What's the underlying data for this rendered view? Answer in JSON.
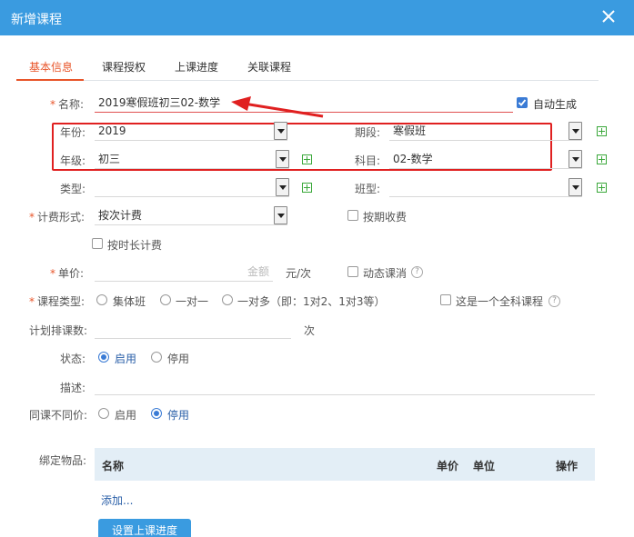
{
  "dialog": {
    "title": "新增课程"
  },
  "tabs": [
    {
      "label": "基本信息"
    },
    {
      "label": "课程授权"
    },
    {
      "label": "上课进度"
    },
    {
      "label": "关联课程"
    }
  ],
  "form": {
    "name_label": "名称:",
    "name_value": "2019寒假班初三02-数学",
    "auto_generate_label": "自动生成",
    "year_label": "年份:",
    "year_value": "2019",
    "period_label": "期段:",
    "period_value": "寒假班",
    "grade_label": "年级:",
    "grade_value": "初三",
    "subject_label": "科目:",
    "subject_value": "02-数学",
    "type_label": "类型:",
    "type_value": "",
    "class_type_label": "班型:",
    "class_type_value": "",
    "billing_label": "计费形式:",
    "billing_value": "按次计费",
    "by_period_label": "按期收费",
    "by_duration_label": "按时长计费",
    "price_label": "单价:",
    "price_placeholder": "金额",
    "price_unit": "元/次",
    "dynamic_cancel_label": "动态课消",
    "course_type_label": "课程类型:",
    "course_type_group": "集体班",
    "course_type_one": "一对一",
    "course_type_many": "一对多（即：1对2、1对3等）",
    "all_subject_label": "这是一个全科课程",
    "planned_count_label": "计划排课数:",
    "planned_count_unit": "次",
    "status_label": "状态:",
    "status_enabled": "启用",
    "status_disabled": "停用",
    "description_label": "描述:",
    "same_course_price_label": "同课不同价:",
    "same_enabled": "启用",
    "same_disabled": "停用",
    "bind_items_label": "绑定物品:",
    "help_glyph": "?"
  },
  "items_table": {
    "headers": [
      "名称",
      "单价",
      "单位",
      "操作"
    ],
    "add_link": "添加..."
  },
  "footer": {
    "set_progress_button": "设置上课进度"
  },
  "colors": {
    "accent": "#3a9be0",
    "active_tab": "#e8552a",
    "annotation": "#e02020"
  }
}
